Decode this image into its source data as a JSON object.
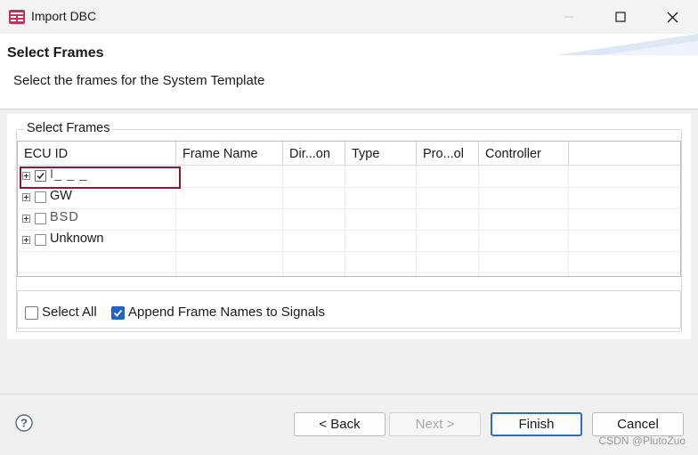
{
  "window": {
    "title": "Import DBC",
    "icon": "dbc-app-icon",
    "controls": [
      "minimize-icon",
      "maximize-icon",
      "close-icon"
    ]
  },
  "banner": {
    "title": "Select Frames",
    "description": "Select the frames for the System Template"
  },
  "frames_group": {
    "label": "Select Frames",
    "columns": [
      "ECU ID",
      "Frame Name",
      "Dir...on",
      "Type",
      "Pro...ol",
      "Controller"
    ],
    "rows": [
      {
        "label": "I_ _ _",
        "checked": true,
        "expander": "plus",
        "highlighted": true
      },
      {
        "label": "GW",
        "checked": false,
        "expander": "plus"
      },
      {
        "label": "BSD",
        "checked": false,
        "expander": "plus"
      },
      {
        "label": "Unknown",
        "checked": false,
        "expander": "plus"
      }
    ]
  },
  "options": {
    "select_all": {
      "label": "Select All",
      "checked": false
    },
    "append_names": {
      "label": "Append Frame Names to Signals",
      "checked": true
    }
  },
  "buttons": {
    "back": "< Back",
    "next": "Next >",
    "finish": "Finish",
    "cancel": "Cancel"
  },
  "watermark": "CSDN @PlutoZuo",
  "colors": {
    "highlight_border": "#8b1a2a",
    "accent": "#1d63c8"
  }
}
